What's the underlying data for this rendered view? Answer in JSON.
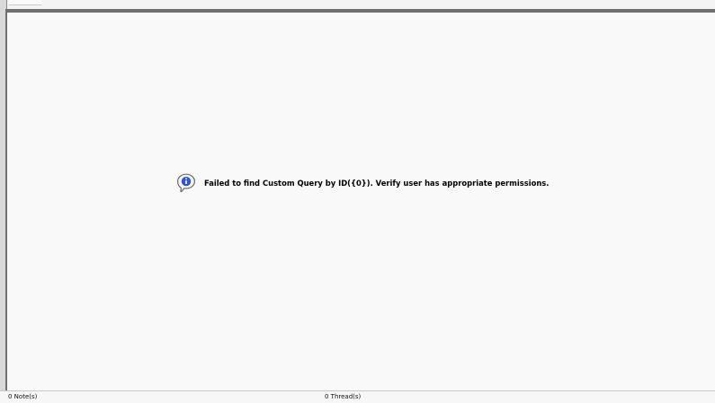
{
  "message": {
    "icon": "info-speech-bubble-icon",
    "text": "Failed to find Custom Query by ID({0}). Verify user has appropriate permissions."
  },
  "status_bar": {
    "notes": "0 Note(s)",
    "threads": "0 Thread(s)"
  },
  "colors": {
    "accent_blue": "#2f55c8",
    "frame_gray": "#6f6f6f",
    "background": "#f9f9f9"
  }
}
